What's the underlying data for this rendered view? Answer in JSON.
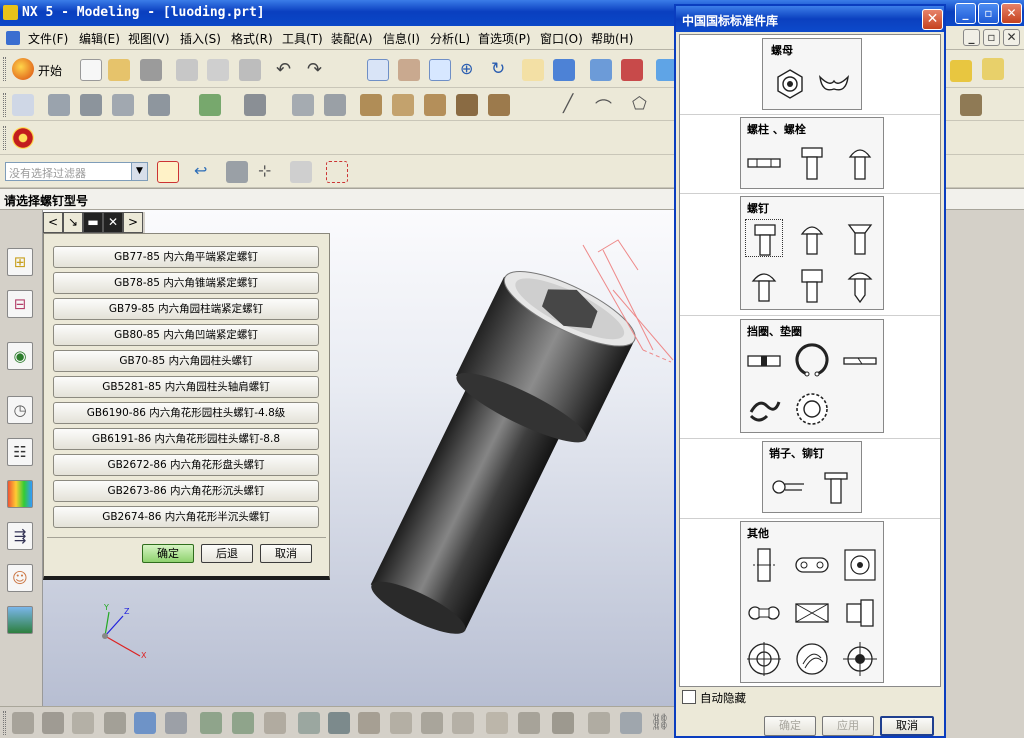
{
  "window": {
    "title": "NX 5 - Modeling - [luoding.prt]",
    "min_label": "_",
    "max_label": "▫",
    "close_label": "✕"
  },
  "menu": {
    "items": [
      "文件(F)",
      "编辑(E)",
      "视图(V)",
      "插入(S)",
      "格式(R)",
      "工具(T)",
      "装配(A)",
      "信息(I)",
      "分析(L)",
      "首选项(P)",
      "窗口(O)",
      "帮助(H)"
    ]
  },
  "toolbar": {
    "start_label": "开始",
    "filter_placeholder": "没有选择过滤器"
  },
  "prompt": {
    "text": "请选择螺钉型号"
  },
  "screw_dialog": {
    "items": [
      "GB77-85 内六角平端紧定螺钉",
      "GB78-85 内六角锥端紧定螺钉",
      "GB79-85 内六角园柱端紧定螺钉",
      "GB80-85 内六角凹端紧定螺钉",
      "GB70-85 内六角园柱头螺钉",
      "GB5281-85 内六角园柱头轴肩螺钉",
      "GB6190-86 内六角花形园柱头螺钉-4.8级",
      "GB6191-86 内六角花形园柱头螺钉-8.8",
      "GB2672-86 内六角花形盘头螺钉",
      "GB2673-86 内六角花形沉头螺钉",
      "GB2674-86 内六角花形半沉头螺钉"
    ],
    "ok_label": "确定",
    "back_label": "后退",
    "cancel_label": "取消"
  },
  "library_panel": {
    "title": "中国国标标准件库",
    "groups": [
      "螺母",
      "螺柱 、螺栓",
      "螺钉",
      "挡圈、垫圈",
      "销子、铆钉",
      "其他"
    ],
    "auto_hide_label": "自动隐藏",
    "ok_label": "确定",
    "apply_label": "应用",
    "cancel_label": "取消"
  },
  "triad": {
    "x": "X",
    "y": "Y",
    "z": "Z"
  },
  "colors": {
    "titlebar": "#0b48c8",
    "viewport_top": "#fbfbfd",
    "viewport_bottom": "#b7bed2",
    "ok_button": "#8fd26f"
  }
}
